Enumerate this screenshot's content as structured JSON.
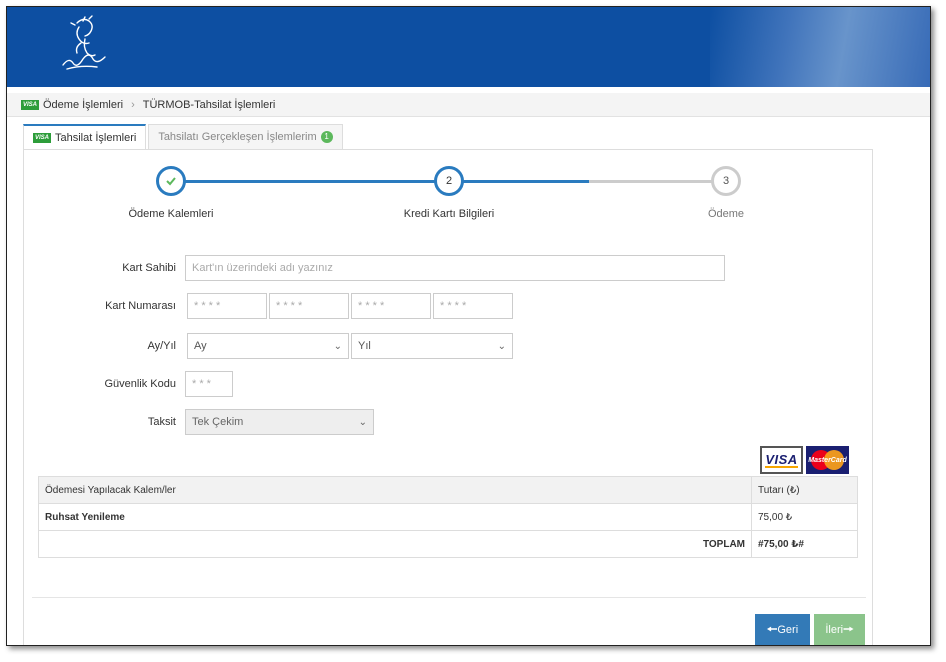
{
  "breadcrumb": {
    "badge": "VISA",
    "item1": "Ödeme İşlemleri",
    "sep": "›",
    "item2": "TÜRMOB-Tahsilat İşlemleri"
  },
  "tabs": [
    {
      "badge": "VISA",
      "label": "Tahsilat İşlemleri"
    },
    {
      "label": "Tahsilatı Gerçekleşen İşlemlerim",
      "count": "1"
    }
  ],
  "wizard": {
    "steps": [
      {
        "number": "",
        "label": "Ödeme Kalemleri",
        "state": "done"
      },
      {
        "number": "2",
        "label": "Kredi Kartı Bilgileri",
        "state": "active"
      },
      {
        "number": "3",
        "label": "Ödeme",
        "state": "todo"
      }
    ],
    "colors": {
      "active": "#2a7bbf",
      "inactive": "#cccccc",
      "done_check": "#5cb85c"
    }
  },
  "form": {
    "card_holder_label": "Kart Sahibi",
    "card_holder_placeholder": "Kart'ın üzerindeki adı yazınız",
    "card_number_label": "Kart Numarası",
    "card_number_placeholders": [
      "* * * *",
      "* * * *",
      "* * * *",
      "* * * *"
    ],
    "expiry_label": "Ay/Yıl",
    "month_value": "Ay",
    "year_value": "Yıl",
    "cvv_label": "Güvenlik Kodu",
    "cvv_placeholder": "* * *",
    "installment_label": "Taksit",
    "installment_value": "Tek Çekim"
  },
  "card_logos": {
    "visa": "VISA",
    "mastercard": "MasterCard"
  },
  "table": {
    "headers": [
      "Ödemesi Yapılacak Kalem/ler",
      "Tutarı (₺)"
    ],
    "rows": [
      {
        "item": "Ruhsat Yenileme",
        "amount": "75,00 ₺"
      }
    ],
    "total_label": "TOPLAM",
    "total_value": "#75,00 ₺#"
  },
  "buttons": {
    "back": "Geri",
    "next": "İleri"
  },
  "colors": {
    "header": "#0d4fa2",
    "back_button": "#337ab7",
    "next_button": "#8bc48b"
  }
}
